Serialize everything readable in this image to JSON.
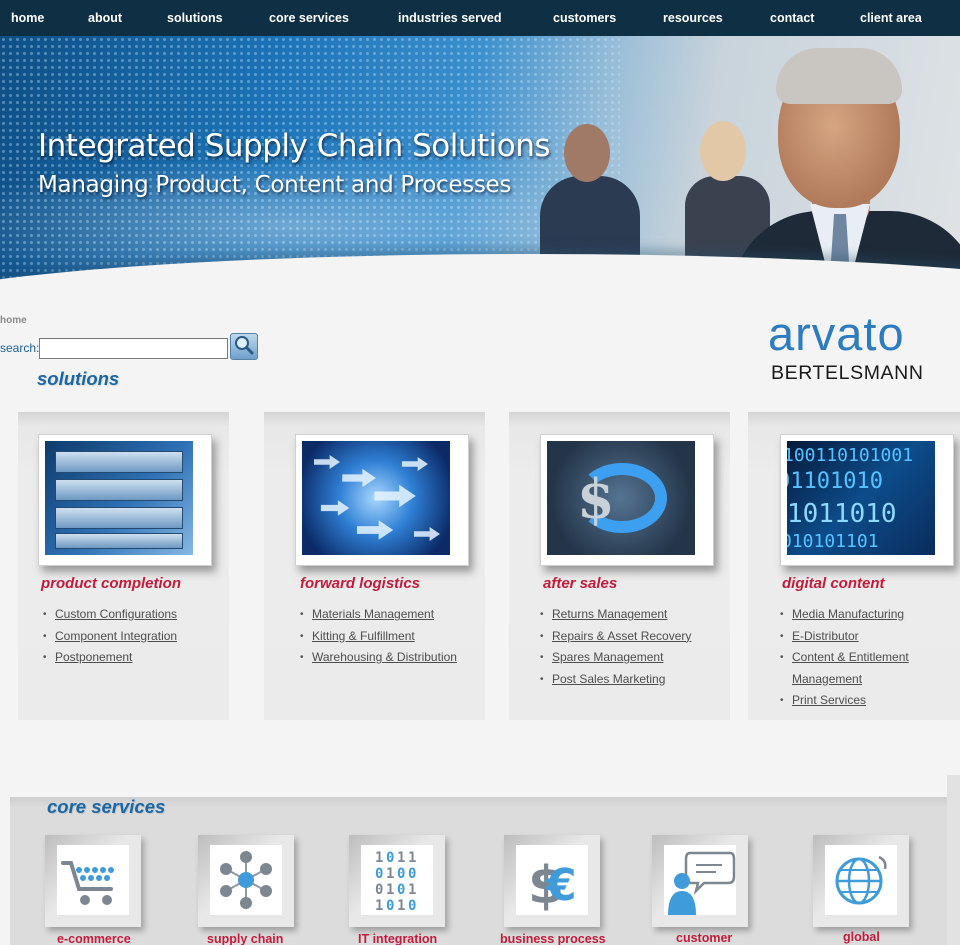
{
  "nav": {
    "items": [
      "home",
      "about",
      "solutions",
      "core services",
      "industries served",
      "customers",
      "resources",
      "contact",
      "client area"
    ]
  },
  "hero": {
    "title": "Integrated Supply Chain Solutions",
    "subtitle": "Managing Product, Content and Processes"
  },
  "breadcrumb": "home",
  "search": {
    "label": "search:",
    "value": "",
    "placeholder": ""
  },
  "logo": {
    "wordmark": "arvato",
    "sub": "BERTELSMANN"
  },
  "solutions": {
    "title": "solutions",
    "cards": [
      {
        "title": "product completion",
        "links": [
          "Custom Configurations",
          "Component Integration",
          "Postponement"
        ]
      },
      {
        "title": "forward logistics",
        "links": [
          "Materials Management",
          "Kitting & Fulfillment",
          "Warehousing & Distribution"
        ]
      },
      {
        "title": "after sales",
        "links": [
          "Returns Management",
          "Repairs & Asset Recovery",
          "Spares Management",
          "Post Sales Marketing"
        ]
      },
      {
        "title": "digital content",
        "links": [
          "Media Manufacturing",
          "E-Distributor",
          "Content & Entitlement",
          "Management",
          "Print Services"
        ]
      }
    ]
  },
  "core_services": {
    "title": "core services",
    "items": [
      {
        "label": "e-commerce",
        "icon": "shopping-cart-icon"
      },
      {
        "label": "supply chain",
        "icon": "network-icon"
      },
      {
        "label": "IT integration",
        "icon": "binary-icon"
      },
      {
        "label": "business process",
        "icon": "currency-icon"
      },
      {
        "label": "customer",
        "icon": "customer-chat-icon"
      },
      {
        "label": "global",
        "icon": "globe-icon"
      }
    ]
  },
  "colors": {
    "nav_bg": "#0e2f44",
    "accent_blue": "#1a67a6",
    "accent_red": "#c21b3c",
    "logo_blue": "#2d7cc1"
  }
}
